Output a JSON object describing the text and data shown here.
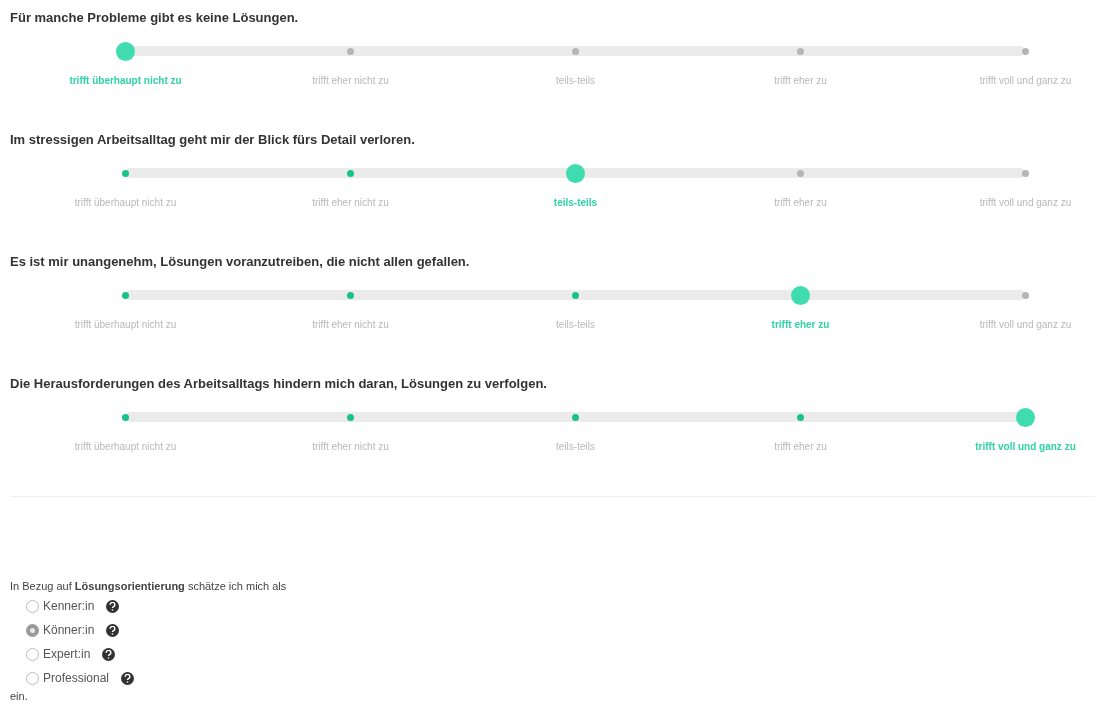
{
  "questions": [
    {
      "title": "Für manche Probleme gibt es keine Lösungen.",
      "options": [
        {
          "label": "trifft überhaupt nicht zu",
          "selected": true
        },
        {
          "label": "trifft eher nicht zu",
          "selected": false
        },
        {
          "label": "teils-teils",
          "selected": false
        },
        {
          "label": "trifft eher zu",
          "selected": false
        },
        {
          "label": "trifft voll und ganz zu",
          "selected": false
        }
      ]
    },
    {
      "title": "Im stressigen Arbeitsalltag geht mir der Blick fürs Detail verloren.",
      "options": [
        {
          "label": "trifft überhaupt nicht zu",
          "selected": false
        },
        {
          "label": "trifft eher nicht zu",
          "selected": false
        },
        {
          "label": "teils-teils",
          "selected": true
        },
        {
          "label": "trifft eher zu",
          "selected": false
        },
        {
          "label": "trifft voll und ganz zu",
          "selected": false
        }
      ]
    },
    {
      "title": "Es ist mir unangenehm, Lösungen voranzutreiben, die nicht allen gefallen.",
      "options": [
        {
          "label": "trifft überhaupt nicht zu",
          "selected": false
        },
        {
          "label": "trifft eher nicht zu",
          "selected": false
        },
        {
          "label": "teils-teils",
          "selected": false
        },
        {
          "label": "trifft eher zu",
          "selected": true
        },
        {
          "label": "trifft voll und ganz zu",
          "selected": false
        }
      ]
    },
    {
      "title": "Die Herausforderungen des Arbeitsalltags hindern mich daran, Lösungen zu verfolgen.",
      "options": [
        {
          "label": "trifft überhaupt nicht zu",
          "selected": false
        },
        {
          "label": "trifft eher nicht zu",
          "selected": false
        },
        {
          "label": "teils-teils",
          "selected": false
        },
        {
          "label": "trifft eher zu",
          "selected": false
        },
        {
          "label": "trifft voll und ganz zu",
          "selected": true
        }
      ]
    }
  ],
  "self_assessment": {
    "intro": "In Bezug auf **Lösungsorientierung** schätze ich mich als",
    "options": [
      {
        "label": "Kenner:in",
        "selected": false
      },
      {
        "label": "Könner:in",
        "selected": true
      },
      {
        "label": "Expert:in",
        "selected": false
      },
      {
        "label": "Professional",
        "selected": false
      }
    ],
    "outro": "ein."
  }
}
